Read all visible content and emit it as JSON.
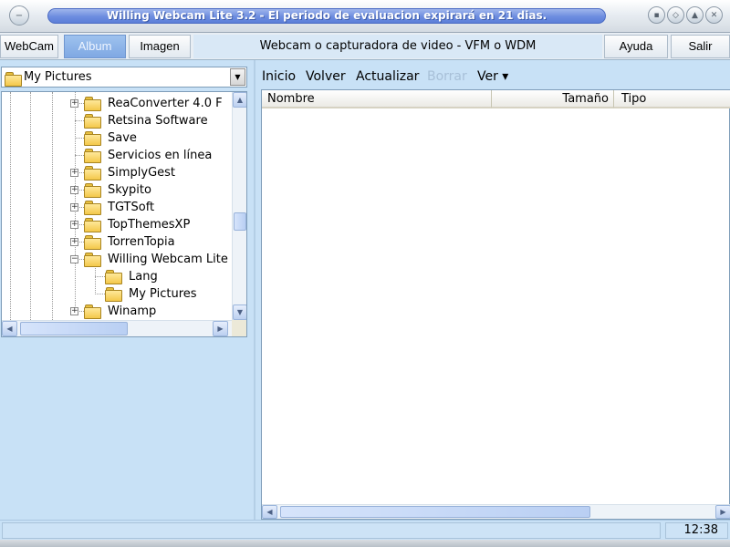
{
  "window": {
    "title": "Willing Webcam Lite 3.2 - El periodo de evaluacion expirará en 21 dias."
  },
  "toolbar": {
    "webcam_label": "WebCam",
    "album_label": "Album",
    "imagen_label": "Imagen",
    "title": "Webcam o capturadora de video - VFM o WDM",
    "ayuda_label": "Ayuda",
    "salir_label": "Salir"
  },
  "folder_combo": {
    "selected": "My Pictures"
  },
  "tree": {
    "items": [
      {
        "label": "ReaConverter 4.0 F",
        "expander": "+",
        "level": 1
      },
      {
        "label": "Retsina Software",
        "expander": "",
        "level": 1
      },
      {
        "label": "Save",
        "expander": "",
        "level": 1
      },
      {
        "label": "Servicios en línea",
        "expander": "",
        "level": 1
      },
      {
        "label": "SimplyGest",
        "expander": "+",
        "level": 1
      },
      {
        "label": "Skypito",
        "expander": "+",
        "level": 1
      },
      {
        "label": "TGTSoft",
        "expander": "+",
        "level": 1
      },
      {
        "label": "TopThemesXP",
        "expander": "+",
        "level": 1
      },
      {
        "label": "TorrenTopia",
        "expander": "+",
        "level": 1
      },
      {
        "label": "Willing Webcam Lite",
        "expander": "−",
        "level": 1
      },
      {
        "label": "Lang",
        "expander": "",
        "level": 2
      },
      {
        "label": "My Pictures",
        "expander": "",
        "level": 2
      },
      {
        "label": "Winamp",
        "expander": "+",
        "level": 1
      }
    ]
  },
  "nav": {
    "inicio": "Inicio",
    "volver": "Volver",
    "actualizar": "Actualizar",
    "borrar": "Borrar",
    "ver": "Ver ▾"
  },
  "file_list": {
    "columns": [
      "Nombre",
      "Tamaño",
      "Tipo"
    ]
  },
  "status": {
    "message": "",
    "clock": "12:38"
  },
  "colors": {
    "background": "#c8e1f6",
    "title_pill": "#6d8de0",
    "active_tab": "#8fb5e8",
    "disabled_text": "#a8c0d8"
  }
}
